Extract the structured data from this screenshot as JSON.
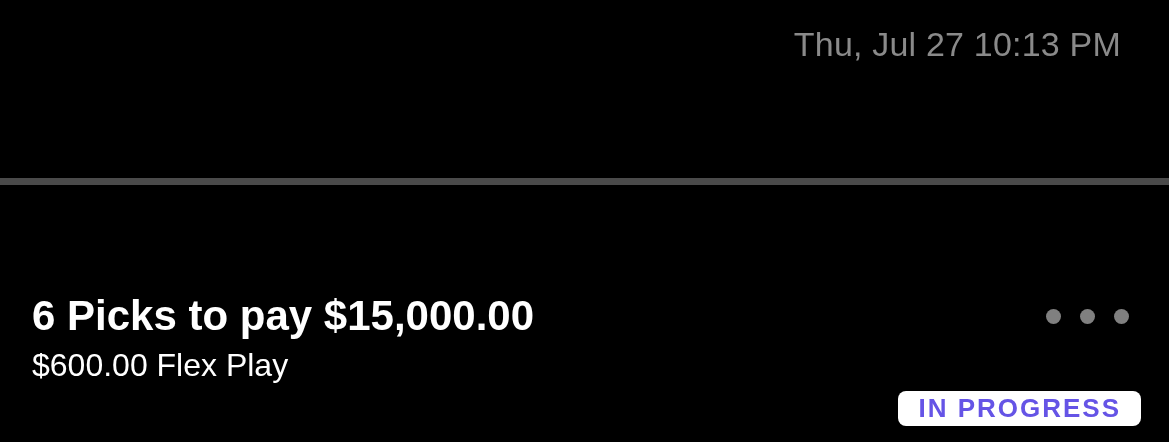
{
  "header": {
    "timestamp": "Thu, Jul 27 10:13 PM"
  },
  "entry": {
    "title": "6 Picks to pay $15,000.00",
    "subtitle": "$600.00 Flex Play",
    "status": "IN PROGRESS"
  }
}
